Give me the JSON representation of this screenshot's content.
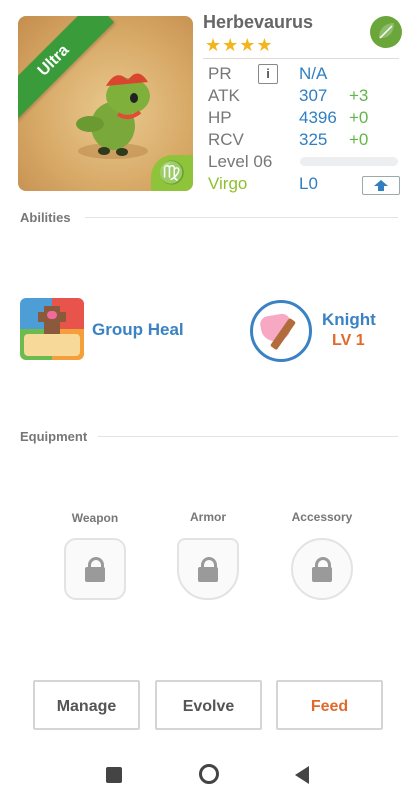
{
  "monster": {
    "name": "Herbevaurus",
    "rarity_badge": "Ultra",
    "stars": "★★★★",
    "zodiac_symbol": "♍",
    "element_icon": "leaf-icon"
  },
  "stats": {
    "pr_label": "PR",
    "pr_info": "i",
    "pr_value": "N/A",
    "atk_label": "ATK",
    "atk_value": "307",
    "atk_plus": "+3",
    "hp_label": "HP",
    "hp_value": "4396",
    "hp_plus": "+0",
    "rcv_label": "RCV",
    "rcv_value": "325",
    "rcv_plus": "+0",
    "level_label": "Level 06",
    "zodiac_label": "Virgo",
    "zodiac_level": "L0"
  },
  "abilities": {
    "title": "Abilities",
    "ability_name": "Group Heal",
    "class_name": "Knight",
    "class_level": "LV 1"
  },
  "equipment": {
    "title": "Equipment",
    "slots": [
      "Weapon",
      "Armor",
      "Accessory"
    ]
  },
  "actions": {
    "manage": "Manage",
    "evolve": "Evolve",
    "feed": "Feed"
  },
  "colors": {
    "accent_blue": "#3a82c4",
    "accent_orange": "#e06a2c",
    "accent_green": "#63b54a",
    "star_gold": "#f3b51b"
  }
}
